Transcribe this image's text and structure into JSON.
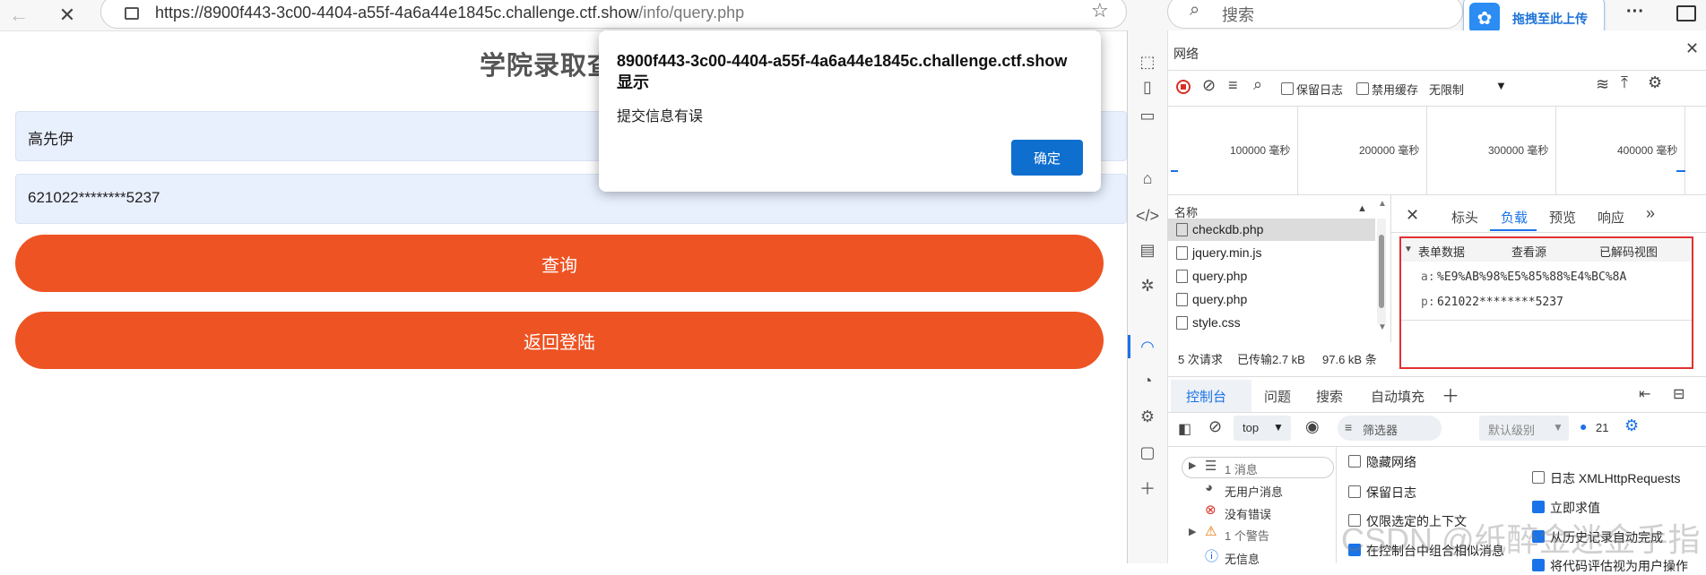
{
  "browser": {
    "url_host": "https://8900f443-3c00-4404-a55f-4a6a44e1845c.challenge.ctf.show",
    "url_path": "/info/query.php",
    "search_placeholder": "搜索",
    "upload_label": "拖拽至此上传",
    "more_label": "···"
  },
  "page": {
    "title": "学院录取查",
    "name_value": "高先伊",
    "id_value": "621022********5237",
    "query_button": "查询",
    "back_button": "返回登陆"
  },
  "dialog": {
    "title": "8900f443-3c00-4404-a55f-4a6a44e1845c.challenge.ctf.show 显示",
    "message": "提交信息有误",
    "ok_label": "确定"
  },
  "devtools": {
    "panel_title": "网络",
    "toolbar": {
      "preserve_log": "保留日志",
      "disable_cache": "禁用缓存",
      "throttle": "无限制"
    },
    "timeline_ticks": [
      "100000 毫秒",
      "200000 毫秒",
      "300000 毫秒",
      "400000 毫秒"
    ],
    "name_header": "名称",
    "files": [
      "checkdb.php",
      "jquery.min.js",
      "query.php",
      "query.php",
      "style.css"
    ],
    "status": {
      "requests": "5 次请求",
      "transferred": "已传输2.7 kB",
      "resources": "97.6 kB 条"
    },
    "detail_tabs": [
      "标头",
      "负载",
      "预览",
      "响应"
    ],
    "form": {
      "section": "表单数据",
      "view_source": "查看源",
      "decoded_view": "已解码视图",
      "a_key": "a:",
      "a_value": "%E9%AB%98%E5%85%88%E4%BC%8A",
      "p_key": "p:",
      "p_value": "621022********5237"
    },
    "drawer_tabs": [
      "控制台",
      "问题",
      "搜索",
      "自动填充"
    ],
    "console": {
      "context": "top",
      "filter_placeholder": "筛选器",
      "level": "默认级别",
      "message_count": "21",
      "sidebar": {
        "messages": "1 消息",
        "user_messages": "无用户消息",
        "errors": "没有错误",
        "warnings": "1 个警告",
        "info": "无信息"
      },
      "options_left": [
        "隐藏网络",
        "保留日志",
        "仅限选定的上下文",
        "在控制台中组合相似消息"
      ],
      "options_right": [
        "日志 XMLHttpRequests",
        "立即求值",
        "从历史记录自动完成",
        "将代码评估视为用户操作"
      ]
    }
  },
  "watermark": "CSDN @纸醉金迷金手指"
}
